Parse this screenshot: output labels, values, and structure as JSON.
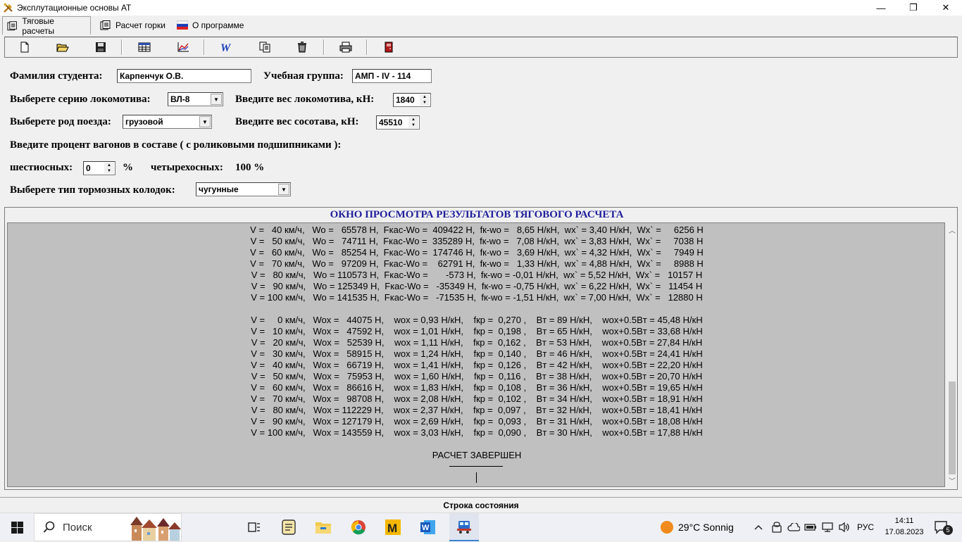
{
  "window": {
    "title": "Эксплутационные основы АТ",
    "min": "—",
    "max": "❐",
    "close": "✕"
  },
  "tabs": [
    {
      "label": "Тяговые расчеты"
    },
    {
      "label": "Расчет горки"
    },
    {
      "label": "О программе"
    }
  ],
  "toolbar": [
    "new-icon",
    "open-icon",
    "save-icon",
    "table-icon",
    "chart-icon",
    "word-icon",
    "copy-icon",
    "trash-icon",
    "print-icon",
    "exit-icon"
  ],
  "form": {
    "student_label": "Фамилия студента:",
    "student_value": "Карпенчук О.В.",
    "group_label": "Учебная группа:",
    "group_value": "АМП - IV - 114",
    "loco_series_label": "Выберете серию локомотива:",
    "loco_series_value": "ВЛ-8",
    "loco_weight_label": "Введите вес локомотива, кН:",
    "loco_weight_value": "1840",
    "train_type_label": "Выберете род поезда:",
    "train_type_value": "грузовой",
    "train_weight_label": "Введите вес сосотава, кН:",
    "train_weight_value": "45510",
    "percent_label": "Введите процент вагонов в составе ( с роликовыми подшипниками ):",
    "six_axle_label": "шестиосных:",
    "six_axle_value": "0",
    "percent_sign": "%",
    "four_axle_label": "четырехосных:",
    "four_axle_value": "100 %",
    "brake_label": "Выберете тип тормозных колодок:",
    "brake_value": "чугунные"
  },
  "results": {
    "title": "ОКНО ПРОСМОТРА РЕЗУЛЬТАТОВ ТЯГОВОГО РАСЧЕТА",
    "block1": [
      "V =   40 км/ч,   Wo =   65578 Н,  Fкас-Wo =  409422 Н,  fк-wo =   8,65 Н/кН,  wx` = 3,40 Н/кН,  Wx` =     6256 Н",
      "V =   50 км/ч,   Wo =   74711 Н,  Fкас-Wo =  335289 Н,  fк-wo =   7,08 Н/кН,  wx` = 3,83 Н/кН,  Wx` =     7038 Н",
      "V =   60 км/ч,   Wo =   85254 Н,  Fкас-Wo =  174746 Н,  fк-wo =   3,69 Н/кН,  wx` = 4,32 Н/кН,  Wx` =     7949 Н",
      "V =   70 км/ч,   Wo =   97209 Н,  Fкас-Wo =    62791 Н,  fк-wo =   1,33 Н/кН,  wx` = 4,88 Н/кН,  Wx` =     8988 Н",
      "V =   80 км/ч,   Wo = 110573 Н,  Fкас-Wo =       -573 Н,  fк-wo = -0,01 Н/кН,  wx` = 5,52 Н/кН,  Wx` =   10157 Н",
      "V =   90 км/ч,   Wo = 125349 Н,  Fкас-Wo =   -35349 Н,  fк-wo = -0,75 Н/кН,  wx` = 6,22 Н/кН,  Wx` =   11454 Н",
      "V = 100 км/ч,   Wo = 141535 Н,  Fкас-Wo =   -71535 Н,  fк-wo = -1,51 Н/кН,  wx` = 7,00 Н/кН,  Wx` =   12880 Н"
    ],
    "block2": [
      "V =     0 км/ч,   Wox =   44075 Н,    wox = 0,93 Н/кН,    fкр =  0,270 ,    Bт = 89 Н/кН,    wox+0.5Bт = 45,48 Н/кН",
      "V =   10 км/ч,   Wox =   47592 Н,    wox = 1,01 Н/кН,    fкр =  0,198 ,    Bт = 65 Н/кН,    wox+0.5Bт = 33,68 Н/кН",
      "V =   20 км/ч,   Wox =   52539 Н,    wox = 1,11 Н/кН,    fкр =  0,162 ,    Bт = 53 Н/кН,    wox+0.5Bт = 27,84 Н/кН",
      "V =   30 км/ч,   Wox =   58915 Н,    wox = 1,24 Н/кН,    fкр =  0,140 ,    Bт = 46 Н/кН,    wox+0.5Bт = 24,41 Н/кН",
      "V =   40 км/ч,   Wox =   66719 Н,    wox = 1,41 Н/кН,    fкр =  0,126 ,    Bт = 42 Н/кН,    wox+0.5Bт = 22,20 Н/кН",
      "V =   50 км/ч,   Wox =   75953 Н,    wox = 1,60 Н/кН,    fкр =  0,116 ,    Bт = 38 Н/кН,    wox+0.5Bт = 20,70 Н/кН",
      "V =   60 км/ч,   Wox =   86616 Н,    wox = 1,83 Н/кН,    fкр =  0,108 ,    Bт = 36 Н/кН,    wox+0.5Bт = 19,65 Н/кН",
      "V =   70 км/ч,   Wox =   98708 Н,    wox = 2,08 Н/кН,    fкр =  0,102 ,    Bт = 34 Н/кН,    wox+0.5Bт = 18,91 Н/кН",
      "V =   80 км/ч,   Wox = 112229 Н,    wox = 2,37 Н/кН,    fкр =  0,097 ,    Bт = 32 Н/кН,    wox+0.5Bт = 18,41 Н/кН",
      "V =   90 км/ч,   Wox = 127179 Н,    wox = 2,69 Н/кН,    fкр =  0,093 ,    Bт = 31 Н/кН,    wox+0.5Bт = 18,08 Н/кН",
      "V = 100 км/ч,   Wox = 143559 Н,    wox = 3,03 Н/кН,    fкр =  0,090 ,    Bт = 30 Н/кН,    wox+0.5Bт = 17,88 Н/кН"
    ],
    "done": "РАСЧЕТ ЗАВЕРШЕН"
  },
  "status": "Строка состояния",
  "taskbar": {
    "search_placeholder": "Поиск",
    "weather": "29°C  Sonnig",
    "lang": "РУС",
    "time": "14:11",
    "date": "17.08.2023",
    "notifications": "5"
  }
}
